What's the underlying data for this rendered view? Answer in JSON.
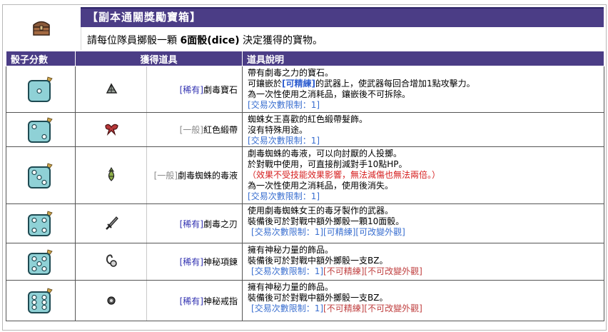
{
  "header": {
    "title": "【副本通關獎勵寶箱】",
    "sub_pre": "請每位隊員擲骰一顆 ",
    "sub_bold": "6面骰(dice)",
    "sub_post": " 決定獲得的寶物。"
  },
  "columns": [
    "骰子分數",
    "獲得道具",
    "道具說明"
  ],
  "rows": [
    {
      "dice": 1,
      "item_icon": "poison-gem-icon",
      "rarity": "[稀有]",
      "item_name": "劇毒寶石",
      "desc_lines": [
        "帶有劇毒之力的寶石。"
      ],
      "desc_mixed": {
        "pre": "可鑲嵌於",
        "highlight": "[可精練]",
        "post": "的武器上，使武器每回合增加1點攻擊力。"
      },
      "desc_after": [
        "為一次性使用之消耗品，鑲嵌後不可拆除。"
      ],
      "trade": "[交易次數限制：1]",
      "trade_extra": []
    },
    {
      "dice": 2,
      "item_icon": "red-ribbon-icon",
      "rarity": "[一般]",
      "item_name": "紅色緞帶",
      "desc_lines": [
        "蜘蛛女王喜歡的紅色緞帶髮飾。",
        "沒有特殊用途。"
      ],
      "trade": "[交易次數限制：1]",
      "trade_extra": []
    },
    {
      "dice": 3,
      "item_icon": "poison-vial-icon",
      "rarity": "[一般]",
      "item_name": "劇毒蜘蛛的毒液",
      "desc_lines": [
        "劇毒蜘蛛的毒液，可以向討厭的人投擲。",
        "於對戰中使用，可直接削減對手10點HP。"
      ],
      "desc_red": "（效果不受技能效果影響，無法減傷也無法兩倍。）",
      "desc_after": [
        "為一次性使用之消耗品，使用後消失。"
      ],
      "trade": "[交易次數限制：1]",
      "trade_extra": []
    },
    {
      "dice": 4,
      "item_icon": "dagger-icon",
      "rarity": "[稀有]",
      "item_name": "劇毒之刃",
      "desc_lines": [
        "使用劇毒蜘蛛女王的毒牙製作的武器。",
        "裝備後可於對戰中額外擲骰一顆10面骰。"
      ],
      "trade": "[交易次數限制：1]",
      "trade_extra": [
        "[可精練]",
        "[可改變外觀]"
      ]
    },
    {
      "dice": 5,
      "item_icon": "necklace-icon",
      "rarity": "[稀有]",
      "item_name": "神秘項鍊",
      "desc_lines": [
        "擁有神秘力量的飾品。",
        "裝備後可於對戰中額外擲骰一支BZ。"
      ],
      "trade": "[交易次數限制：1]",
      "trade_extra_red": [
        "[不可精練]",
        "[不可改變外觀]"
      ]
    },
    {
      "dice": 6,
      "item_icon": "ring-icon",
      "rarity": "[稀有]",
      "item_name": "神秘戒指",
      "desc_lines": [
        "擁有神秘力量的飾品。",
        "裝備後可於對戰中額外擲骰一支BZ。"
      ],
      "trade": "[交易次數限制：1]",
      "trade_extra_red": [
        "[不可精練]",
        "[不可改變外觀]"
      ]
    }
  ],
  "colors": {
    "header_bg": "#4b3d86",
    "dice_fill": "#8fd1d6",
    "rare": "#2f2fb0",
    "trade": "#3a6fd0",
    "warn": "#d62020"
  }
}
